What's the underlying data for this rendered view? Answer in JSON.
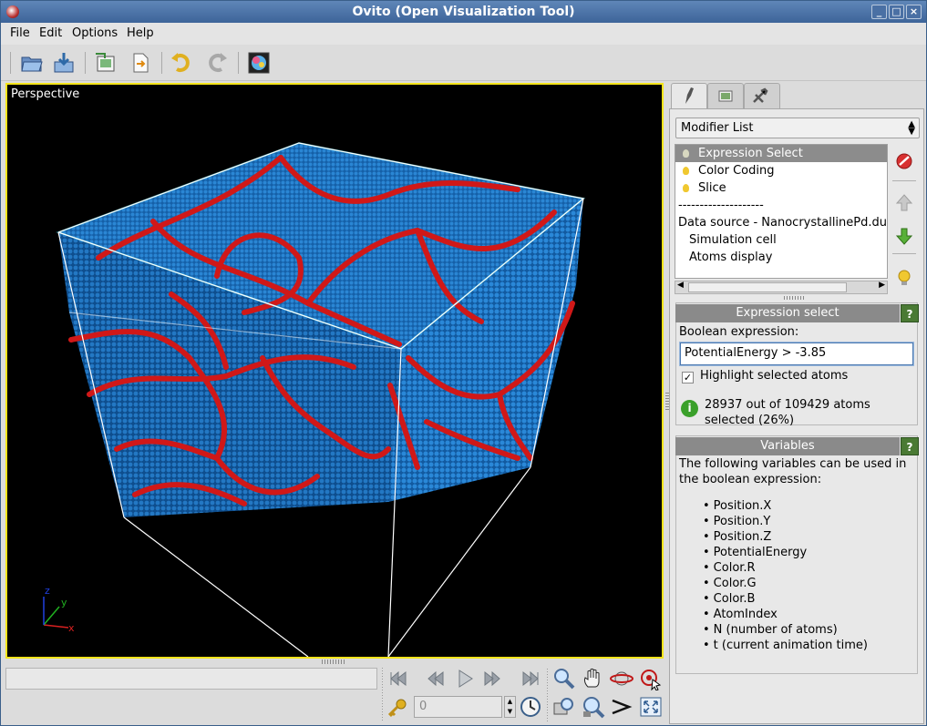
{
  "window": {
    "title": "Ovito (Open Visualization Tool)",
    "controls": {
      "minimize": "_",
      "maximize": "□",
      "close": "×"
    }
  },
  "menu": {
    "items": [
      "File",
      "Edit",
      "Options",
      "Help"
    ]
  },
  "toolbar": {
    "icons": [
      "open-folder-icon",
      "import-file-icon",
      "export-image-icon",
      "export-file-icon",
      "undo-icon",
      "redo-icon",
      "render-icon"
    ]
  },
  "viewport": {
    "label": "Perspective",
    "axis": {
      "x": "x",
      "y": "y",
      "z": "z"
    },
    "colors": {
      "background": "#000000",
      "border": "#f4e41a",
      "atom": "#1e7ac8",
      "selected": "#d41c1c",
      "edge": "#46c8d8"
    }
  },
  "animation": {
    "frame_value": "0",
    "icons": [
      "go-to-start-icon",
      "step-back-icon",
      "play-icon",
      "step-forward-icon",
      "go-to-end-icon",
      "key-icon",
      "clock-icon"
    ]
  },
  "nav_tools": {
    "icons": [
      "zoom-icon",
      "pan-icon",
      "orbit-icon",
      "pick-orbit-center-icon",
      "fov-icon",
      "zoom-extents-icon",
      "perspective-icon",
      "maximize-viewport-icon"
    ]
  },
  "panel": {
    "tabs": [
      "modify-tab",
      "render-tab",
      "utilities-tab"
    ],
    "modifier_combo": "Modifier List",
    "modifier_list": [
      {
        "label": "Expression Select",
        "selected": true,
        "bulb": "dim"
      },
      {
        "label": "Color Coding",
        "selected": false,
        "bulb": "on"
      },
      {
        "label": "Slice",
        "selected": false,
        "bulb": "on"
      },
      {
        "label": "--------------------",
        "selected": false,
        "bulb": "none"
      },
      {
        "label": "Data source - NanocrystallinePd.dump",
        "selected": false,
        "bulb": "none"
      },
      {
        "label": "Simulation cell",
        "selected": false,
        "bulb": "none"
      },
      {
        "label": "Atoms display",
        "selected": false,
        "bulb": "none"
      }
    ],
    "expression_select": {
      "section_title": "Expression select",
      "help": "?",
      "boolean_label": "Boolean expression:",
      "expression_value": "PotentialEnergy > -3.85",
      "highlight_label": "Highlight selected atoms",
      "highlight_checked": true,
      "status_line1": "28937 out of 109429 atoms",
      "status_line2": "selected (26%)"
    },
    "variables": {
      "section_title": "Variables",
      "help": "?",
      "intro_line1": "The following variables can be used in",
      "intro_line2": "the boolean expression:",
      "items": [
        "Position.X",
        "Position.Y",
        "Position.Z",
        "PotentialEnergy",
        "Color.R",
        "Color.G",
        "Color.B",
        "AtomIndex",
        "N (number of atoms)",
        "t (current animation time)"
      ]
    }
  }
}
